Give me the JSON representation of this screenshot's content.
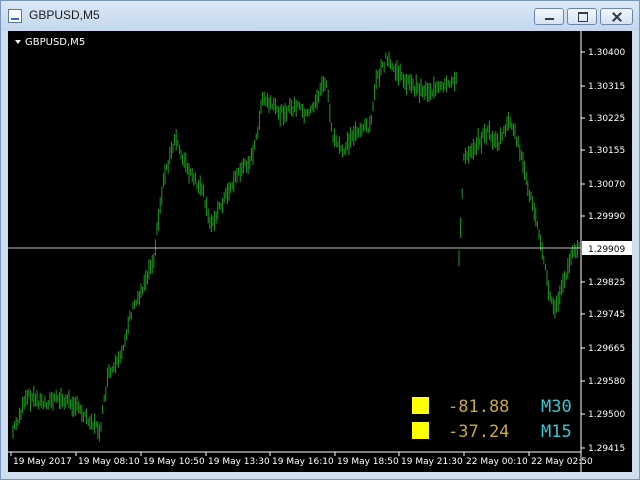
{
  "window": {
    "title": "GBPUSD,M5"
  },
  "chart": {
    "label": "GBPUSD,M5",
    "current_price": "1.29909",
    "price_ticks": [
      "1.30400",
      "1.30315",
      "1.30225",
      "1.30155",
      "1.30070",
      "1.29990",
      "1.29825",
      "1.29745",
      "1.29665",
      "1.29580",
      "1.29500",
      "1.29415"
    ],
    "time_ticks": [
      "19 May 2017",
      "19 May 08:10",
      "19 May 10:50",
      "19 May 13:30",
      "19 May 16:10",
      "19 May 18:50",
      "19 May 21:30",
      "22 May 00:10",
      "22 May 02:50"
    ],
    "colors": {
      "background": "#000000",
      "bars": "#1f9a1f",
      "price_line": "#c0c0c0",
      "indicator_square": "#ffff00",
      "indicator_value": "#c8a83a",
      "indicator_timeframe": "#39c5d4"
    }
  },
  "indicators": [
    {
      "value": "-81.88",
      "timeframe": "M30"
    },
    {
      "value": "-37.24",
      "timeframe": "M15"
    }
  ]
}
